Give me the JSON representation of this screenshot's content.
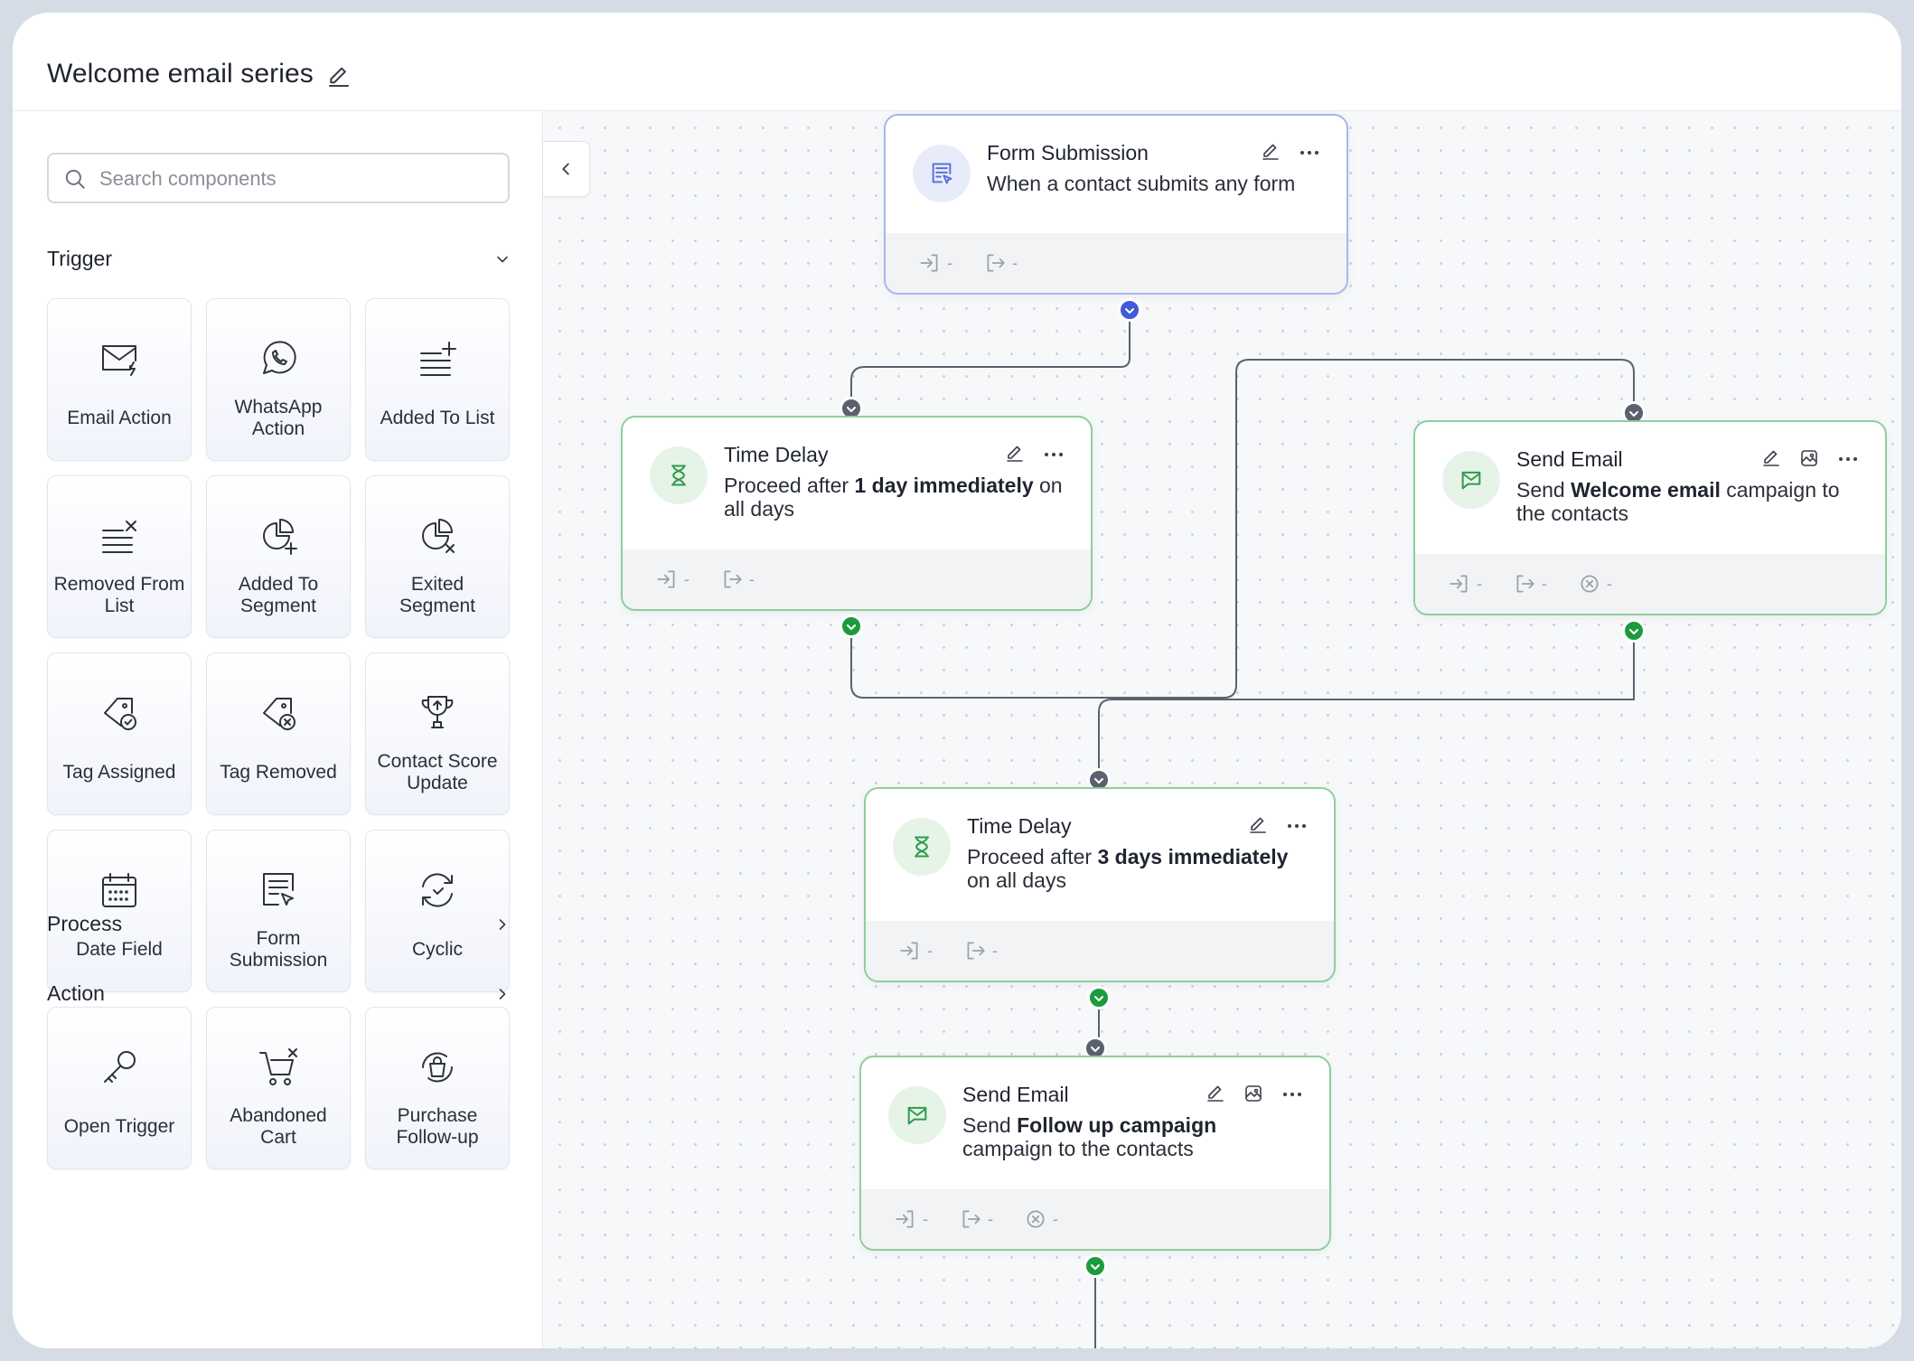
{
  "app": {
    "workflow_title": "Welcome email series"
  },
  "sidebar": {
    "search_placeholder": "Search components",
    "trigger_section": "Trigger",
    "process_section": "Process",
    "action_section": "Action",
    "components": [
      {
        "label": "Email Action",
        "icon": "email-action-icon"
      },
      {
        "label": "WhatsApp Action",
        "icon": "whatsapp-icon"
      },
      {
        "label": "Added To List",
        "icon": "list-add-icon"
      },
      {
        "label": "Removed From List",
        "icon": "list-remove-icon"
      },
      {
        "label": "Added To Segment",
        "icon": "segment-add-icon"
      },
      {
        "label": "Exited Segment",
        "icon": "segment-exit-icon"
      },
      {
        "label": "Tag Assigned",
        "icon": "tag-check-icon"
      },
      {
        "label": "Tag Removed",
        "icon": "tag-remove-icon"
      },
      {
        "label": "Contact Score Update",
        "icon": "trophy-icon"
      },
      {
        "label": "Date Field",
        "icon": "calendar-icon"
      },
      {
        "label": "Form Submission",
        "icon": "form-icon"
      },
      {
        "label": "Cyclic",
        "icon": "cyclic-icon"
      },
      {
        "label": "Open Trigger",
        "icon": "key-icon"
      },
      {
        "label": "Abandoned Cart",
        "icon": "cart-icon"
      },
      {
        "label": "Purchase Follow-up",
        "icon": "purchase-bag-icon"
      }
    ]
  },
  "canvas": {
    "nodes": {
      "form_submission": {
        "title": "Form Submission",
        "desc": "When a contact submits any form",
        "stat_in": "-",
        "stat_out": "-"
      },
      "time_delay_1": {
        "title": "Time Delay",
        "desc_pre": "Proceed after ",
        "desc_bold": "1 day immediately",
        "desc_post": " on all days",
        "stat_in": "-",
        "stat_out": "-"
      },
      "send_email_1": {
        "title": "Send Email",
        "desc_pre": "Send ",
        "desc_bold": "Welcome email",
        "desc_post": " campaign to the contacts",
        "stat_in": "-",
        "stat_out": "-",
        "stat_fail": "-"
      },
      "time_delay_2": {
        "title": "Time Delay",
        "desc_pre": "Proceed after ",
        "desc_bold": "3 days immediately",
        "desc_post": " on all days",
        "stat_in": "-",
        "stat_out": "-"
      },
      "send_email_2": {
        "title": "Send Email",
        "desc_pre": "Send ",
        "desc_bold": "Follow up campaign",
        "desc_post": " campaign to the contacts",
        "stat_in": "-",
        "stat_out": "-",
        "stat_fail": "-"
      }
    }
  },
  "colors": {
    "trigger_border": "#a9b6ee",
    "node_border": "#8fce9c",
    "success_dot": "#1c9b3e",
    "trigger_dot": "#3e5bd9",
    "connector": "#5b6170"
  }
}
